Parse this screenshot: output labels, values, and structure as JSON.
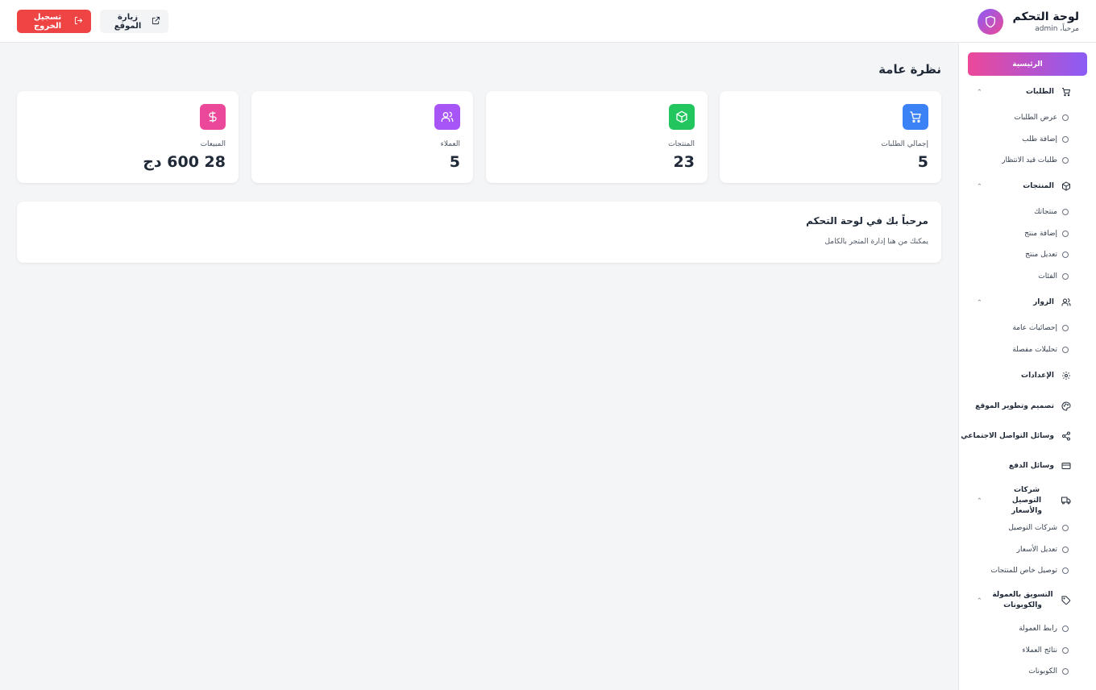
{
  "header": {
    "title": "لوحة التحكم",
    "greeting": "مرحباً، admin",
    "logout_label": "تسجيل الخروج",
    "visit_label": "زيارة الموقع"
  },
  "sidebar": {
    "home_label": "الرئيسية",
    "orders": {
      "label": "الطلبات",
      "items": [
        "عرض الطلبات",
        "إضافة طلب",
        "طلبات قيد الانتظار"
      ]
    },
    "products": {
      "label": "المنتجات",
      "items": [
        "منتجاتك",
        "إضافة منتج",
        "تعديل منتج",
        "الفئات"
      ]
    },
    "visitors": {
      "label": "الزوار",
      "items": [
        "إحصائيات عامة",
        "تحليلات مفصلة"
      ]
    },
    "settings_label": "الإعدادات",
    "design_label": "تصميم وتطوير الموقع",
    "social_label": "وسائل التواصل الاجتماعي",
    "payment_label": "وسائل الدفع",
    "shipping": {
      "label": "شركات التوصيل والأسعار",
      "items": [
        "شركات التوصيل",
        "تعديل الأسعار",
        "توصيل خاص للمنتجات"
      ]
    },
    "affiliate": {
      "label": "التسويق بالعمولة والكوبونات",
      "items": [
        "رابط العمولة",
        "نتائج العملاء",
        "الكوبونات"
      ]
    }
  },
  "main": {
    "page_title": "نظرة عامة",
    "stats": [
      {
        "label": "إجمالي الطلبات",
        "value": "5",
        "icon": "cart-icon",
        "color": "#3b82f6"
      },
      {
        "label": "المنتجات",
        "value": "23",
        "icon": "box-icon",
        "color": "#22c55e"
      },
      {
        "label": "العملاء",
        "value": "5",
        "icon": "users-icon",
        "color": "#a855f7"
      },
      {
        "label": "المبيعات",
        "value": "28 600 دج",
        "icon": "dollar-icon",
        "color": "#ec4899"
      }
    ],
    "welcome": {
      "title": "مرحباً بك في لوحة التحكم",
      "text": "يمكنك من هنا إدارة المتجر بالكامل"
    }
  },
  "colors": {
    "logout": "#ef4444",
    "home_gradient_start": "#ec4899",
    "home_gradient_end": "#8b5cf6"
  }
}
